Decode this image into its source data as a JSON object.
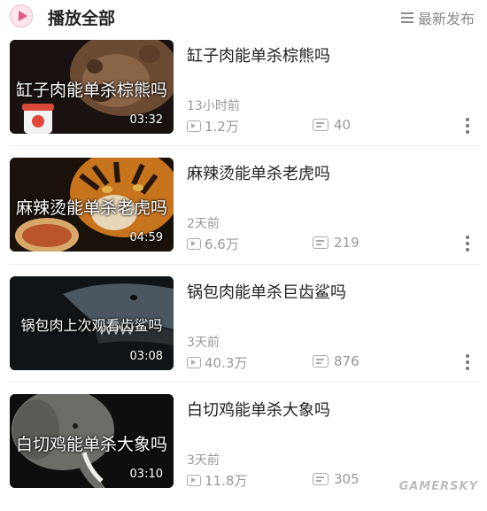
{
  "header": {
    "play_all_label": "播放全部",
    "sort_label": "最新发布"
  },
  "videos": [
    {
      "title": "缸子肉能单杀棕熊吗",
      "thumb_caption": "缸子肉能单杀棕熊吗",
      "duration": "03:32",
      "posted": "13小时前",
      "plays": "1.2万",
      "danmaku": "40"
    },
    {
      "title": "麻辣烫能单杀老虎吗",
      "thumb_caption": "麻辣烫能单杀老虎吗",
      "duration": "04:59",
      "posted": "2天前",
      "plays": "6.6万",
      "danmaku": "219"
    },
    {
      "title": "锅包肉能单杀巨齿鲨吗",
      "thumb_caption": "锅包肉上次观看齿鲨吗",
      "duration": "03:08",
      "posted": "3天前",
      "plays": "40.3万",
      "danmaku": "876"
    },
    {
      "title": "白切鸡能单杀大象吗",
      "thumb_caption": "白切鸡能单杀大象吗",
      "duration": "03:10",
      "posted": "3天前",
      "plays": "11.8万",
      "danmaku": "305"
    }
  ],
  "watermark": "GAMERSKY",
  "colors": {
    "accent": "#e05a85",
    "meta_text": "#999999"
  }
}
